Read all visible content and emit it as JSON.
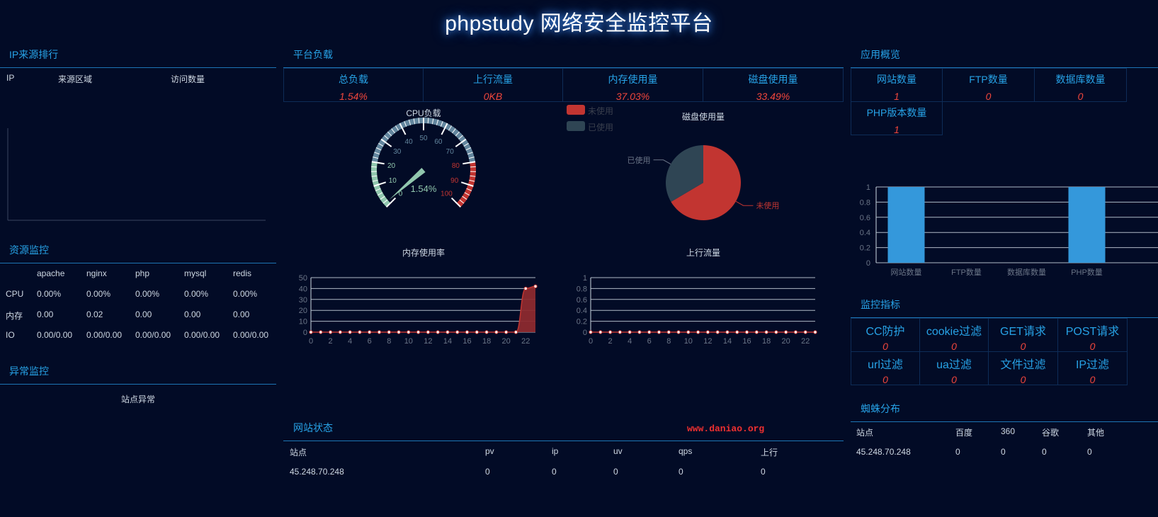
{
  "page": {
    "title": "phpstudy 网络安全监控平台"
  },
  "ip_rank": {
    "title": "IP来源排行",
    "columns": [
      "IP",
      "来源区域",
      "访问数量"
    ]
  },
  "resource": {
    "title": "资源监控",
    "columns": [
      "",
      "apache",
      "nginx",
      "php",
      "mysql",
      "redis"
    ],
    "rows": [
      [
        "CPU",
        "0.00%",
        "0.00%",
        "0.00%",
        "0.00%",
        "0.00%"
      ],
      [
        "内存",
        "0.00",
        "0.02",
        "0.00",
        "0.00",
        "0.00"
      ],
      [
        "IO",
        "0.00/0.00",
        "0.00/0.00",
        "0.00/0.00",
        "0.00/0.00",
        "0.00/0.00"
      ]
    ]
  },
  "anomaly": {
    "title": "异常监控",
    "header": "站点异常"
  },
  "platform": {
    "title": "平台负载",
    "stats": [
      {
        "label": "总负载",
        "value": "1.54%"
      },
      {
        "label": "上行流量",
        "value": "0KB"
      },
      {
        "label": "内存使用量",
        "value": "37.03%"
      },
      {
        "label": "磁盘使用量",
        "value": "33.49%"
      }
    ]
  },
  "cpu_gauge": {
    "title": "CPU负载",
    "value_text": "1.54%",
    "ticks": [
      "0",
      "10",
      "20",
      "30",
      "40",
      "50",
      "60",
      "70",
      "80",
      "90",
      "100"
    ]
  },
  "disk_pie": {
    "title": "磁盘使用量",
    "legend": [
      "未使用",
      "已使用"
    ],
    "label_used": "已使用",
    "label_unused": "未使用"
  },
  "memory_chart": {
    "title": "内存使用率",
    "y_ticks": [
      "50",
      "40",
      "30",
      "20",
      "10",
      "0"
    ],
    "x_ticks": [
      "0",
      "2",
      "4",
      "6",
      "8",
      "10",
      "12",
      "14",
      "16",
      "18",
      "20",
      "22"
    ]
  },
  "upload_chart": {
    "title": "上行流量",
    "y_ticks": [
      "1",
      "0.8",
      "0.6",
      "0.4",
      "0.2",
      "0"
    ],
    "x_ticks": [
      "0",
      "2",
      "4",
      "6",
      "8",
      "10",
      "12",
      "14",
      "16",
      "18",
      "20",
      "22"
    ]
  },
  "site_status": {
    "title": "网站状态",
    "columns": [
      "站点",
      "pv",
      "ip",
      "uv",
      "qps",
      "上行"
    ],
    "rows": [
      [
        "45.248.70.248",
        "0",
        "0",
        "0",
        "0",
        "0"
      ]
    ]
  },
  "watermark": "www.daniao.org",
  "app_overview": {
    "title": "应用概览",
    "stats": [
      {
        "label": "网站数量",
        "value": "1"
      },
      {
        "label": "FTP数量",
        "value": "0"
      },
      {
        "label": "数据库数量",
        "value": "0"
      },
      {
        "label": "PHP版本数量",
        "value": "1"
      }
    ]
  },
  "app_chart": {
    "y_ticks": [
      "1",
      "0.8",
      "0.6",
      "0.4",
      "0.2",
      "0"
    ],
    "categories": [
      "网站数量",
      "FTP数量",
      "数据库数量",
      "PHP数量"
    ]
  },
  "monitor": {
    "title": "监控指标",
    "items": [
      {
        "label": "CC防护",
        "value": "0"
      },
      {
        "label": "cookie过滤",
        "value": "0"
      },
      {
        "label": "GET请求",
        "value": "0"
      },
      {
        "label": "POST请求",
        "value": "0"
      },
      {
        "label": "url过滤",
        "value": "0"
      },
      {
        "label": "ua过滤",
        "value": "0"
      },
      {
        "label": "文件过滤",
        "value": "0"
      },
      {
        "label": "IP过滤",
        "value": "0"
      }
    ]
  },
  "spider": {
    "title": "蜘蛛分布",
    "columns": [
      "站点",
      "百度",
      "360",
      "谷歌",
      "其他"
    ],
    "rows": [
      [
        "45.248.70.248",
        "0",
        "0",
        "0",
        "0"
      ]
    ]
  },
  "chart_data": [
    {
      "type": "gauge",
      "title": "CPU负载",
      "value": 1.54,
      "min": 0,
      "max": 100
    },
    {
      "type": "pie",
      "title": "磁盘使用量",
      "labels": [
        "未使用",
        "已使用"
      ],
      "values": [
        66.51,
        33.49
      ],
      "colors": [
        "#c23531",
        "#2f4554"
      ]
    },
    {
      "type": "area",
      "title": "内存使用率",
      "x": [
        0,
        1,
        2,
        3,
        4,
        5,
        6,
        7,
        8,
        9,
        10,
        11,
        12,
        13,
        14,
        15,
        16,
        17,
        18,
        19,
        20,
        21,
        22,
        23
      ],
      "values": [
        0,
        0,
        0,
        0,
        0,
        0,
        0,
        0,
        0,
        0,
        0,
        0,
        0,
        0,
        0,
        0,
        0,
        0,
        0,
        0,
        0,
        0,
        40,
        42
      ],
      "ylim": [
        0,
        50
      ]
    },
    {
      "type": "line",
      "title": "上行流量",
      "x": [
        0,
        1,
        2,
        3,
        4,
        5,
        6,
        7,
        8,
        9,
        10,
        11,
        12,
        13,
        14,
        15,
        16,
        17,
        18,
        19,
        20,
        21,
        22,
        23
      ],
      "values": [
        0,
        0,
        0,
        0,
        0,
        0,
        0,
        0,
        0,
        0,
        0,
        0,
        0,
        0,
        0,
        0,
        0,
        0,
        0,
        0,
        0,
        0,
        0,
        0
      ],
      "ylim": [
        0,
        1
      ]
    },
    {
      "type": "bar",
      "categories": [
        "网站数量",
        "FTP数量",
        "数据库数量",
        "PHP数量"
      ],
      "values": [
        1,
        0,
        0,
        1
      ],
      "ylim": [
        0,
        1
      ]
    }
  ]
}
